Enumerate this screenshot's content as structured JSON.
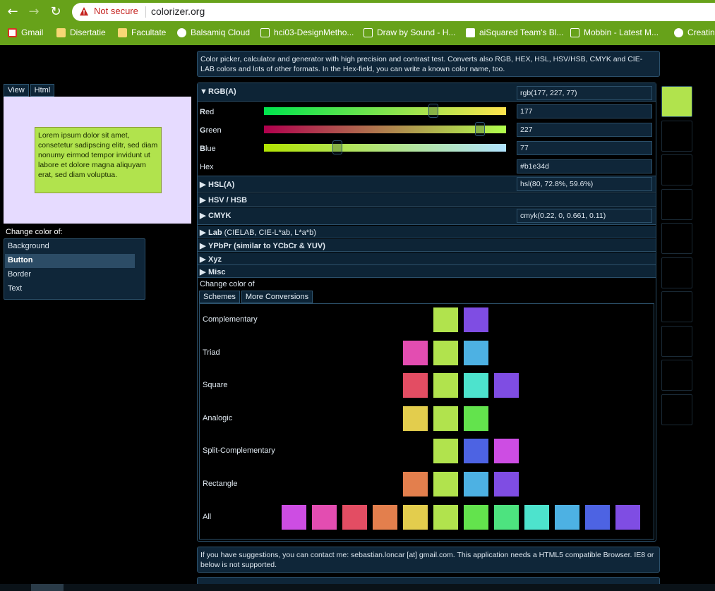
{
  "browser": {
    "url": "colorizer.org",
    "security_text": "Not secure",
    "bookmarks": [
      "Gmail",
      "Disertatie",
      "Facultate",
      "Balsamiq Cloud",
      "hci03-DesignMetho...",
      "Draw by Sound - H...",
      "aiSquared Team's Bl...",
      "Mobbin - Latest M...",
      "Creatin"
    ]
  },
  "intro": "Color picker, calculator and generator with high precision and contrast test. Converts also RGB, HEX, HSL, HSV/HSB, CMYK and CIE-LAB colors and lots of other formats. In the Hex-field, you can write a known color name, too.",
  "preview": {
    "tabs": [
      "View",
      "Html"
    ],
    "lorem": "Lorem ipsum dolor sit amet, consetetur sadipscing elitr, sed diam nonumy eirmod tempor invidunt ut labore et dolore magna aliquyam erat, sed diam voluptua.",
    "change_label": "Change color of:",
    "targets": [
      "Background",
      "Button",
      "Border",
      "Text"
    ],
    "selected_target": "Button"
  },
  "rgb": {
    "header": "RGB(A)",
    "value_text": "rgb(177, 227, 77)",
    "red_initial": "R",
    "red_rest": "ed",
    "red": "177",
    "green_initial": "G",
    "green_rest": "reen",
    "green": "227",
    "blue_initial": "B",
    "blue_rest": "lue",
    "blue": "77",
    "hex_label": "Hex",
    "hex": "#b1e34d"
  },
  "sections": {
    "hsl": {
      "label": "HSL(A)",
      "value": "hsl(80, 72.8%, 59.6%)"
    },
    "hsv": {
      "label": "HSV / HSB"
    },
    "cmyk": {
      "label": "CMYK",
      "value": "cmyk(0.22, 0, 0.661, 0.11)"
    },
    "lab": {
      "label": "Lab",
      "sub": "(CIELAB, CIE-L*ab, L*a*b)"
    },
    "ypbpr": {
      "label": "YPbPr (similar to YCbCr & YUV)"
    },
    "xyz": {
      "label": "Xyz"
    },
    "misc": {
      "label": "Misc"
    }
  },
  "schemes": {
    "change_label": "Change color of",
    "tabs": [
      "Schemes",
      "More Conversions"
    ],
    "rows": [
      {
        "name": "Complementary",
        "colors": [
          "#b1e34d",
          "#7f4de3"
        ]
      },
      {
        "name": "Triad",
        "colors": [
          "#e34db1",
          "#b1e34d",
          "#4db1e3"
        ]
      },
      {
        "name": "Square",
        "colors": [
          "#e34d63",
          "#b1e34d",
          "#4de3cd",
          "#7f4de3"
        ]
      },
      {
        "name": "Analogic",
        "colors": [
          "#e3cd4d",
          "#b1e34d",
          "#63e34d"
        ]
      },
      {
        "name": "Split-Complementary",
        "colors": [
          "#b1e34d",
          "#4d63e3",
          "#cd4de3"
        ]
      },
      {
        "name": "Rectangle",
        "colors": [
          "#e37f4d",
          "#b1e34d",
          "#4db1e3",
          "#7f4de3"
        ]
      },
      {
        "name": "All",
        "colors": [
          "#cd4de3",
          "#e34db1",
          "#e34d63",
          "#e37f4d",
          "#e3cd4d",
          "#b1e34d",
          "#63e34d",
          "#4de37f",
          "#4de3cd",
          "#4db1e3",
          "#4d63e3",
          "#7f4de3"
        ]
      }
    ]
  },
  "history": [
    "#b1e34d",
    "",
    "",
    "",
    "",
    "",
    "",
    "",
    "",
    ""
  ],
  "footer": "If you have suggestions, you can contact me: sebastian.loncar [at] gmail.com. This application needs a HTML5 compatible Browser. IE8 or below is not supported.",
  "colors": {
    "chrome": "#67a21a",
    "panel": "#0f2639",
    "panel_border": "#2b4f69",
    "current": "#b1e34d",
    "preview_bg": "#e6dbff"
  }
}
